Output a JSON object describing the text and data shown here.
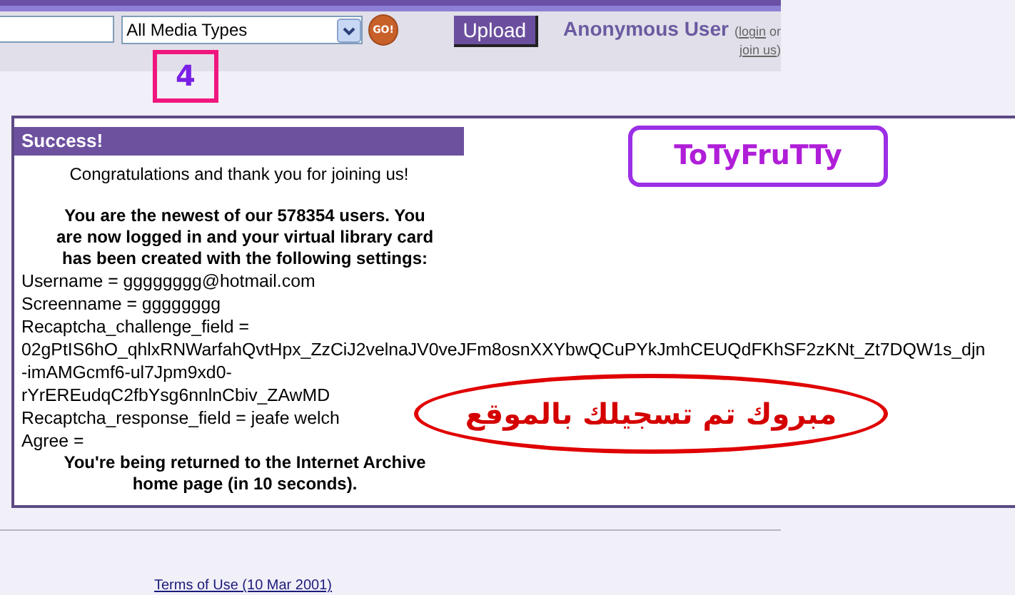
{
  "header": {
    "media_select": {
      "value": "All Media Types"
    },
    "go_button": "GO!",
    "upload_button": "Upload",
    "user": {
      "name": "Anonymous User",
      "prefix": "(",
      "login_link": "login",
      "middle": "or",
      "join_link": "join us",
      "suffix": ")"
    }
  },
  "annotations": {
    "step_label": "4",
    "tag": "ToTyFruTTy",
    "arabic_note": "مبروك تم تسجيلك بالموقع"
  },
  "panel": {
    "title": "Success!",
    "lines": [
      {
        "kind": "centered",
        "text": "Congratulations and thank you for joining us!"
      },
      {
        "kind": "spacer"
      },
      {
        "kind": "centered_bold",
        "text": "You are the newest of our 578354 users. You are now logged in and your virtual library card has been created with the following settings:"
      },
      {
        "kind": "plain",
        "text": "Username = gggggggg@hotmail.com"
      },
      {
        "kind": "plain",
        "text": "Screenname = gggggggg"
      },
      {
        "kind": "plain",
        "text": "Recaptcha_challenge_field ="
      },
      {
        "kind": "plain",
        "text": "02gPtIS6hO_qhlxRNWarfahQvtHpx_ZzCiJ2velnaJV0veJFm8osnXXYbwQCuPYkJmhCEUQdFKhSF2zKNt_Zt7DQW1s_djn"
      },
      {
        "kind": "plain",
        "text": "-imAMGcmf6-ul7Jpm9xd0-"
      },
      {
        "kind": "plain",
        "text": "rYrEREudqC2fbYsg6nnlnCbiv_ZAwMD"
      },
      {
        "kind": "plain",
        "text": "Recaptcha_response_field = jeafe welch"
      },
      {
        "kind": "plain",
        "text": "Agree ="
      },
      {
        "kind": "centered_bold",
        "text": "You're being returned to the Internet Archive home page (in 10 seconds)."
      }
    ]
  },
  "footer": {
    "terms_link": "Terms of Use (10 Mar 2001)"
  }
}
